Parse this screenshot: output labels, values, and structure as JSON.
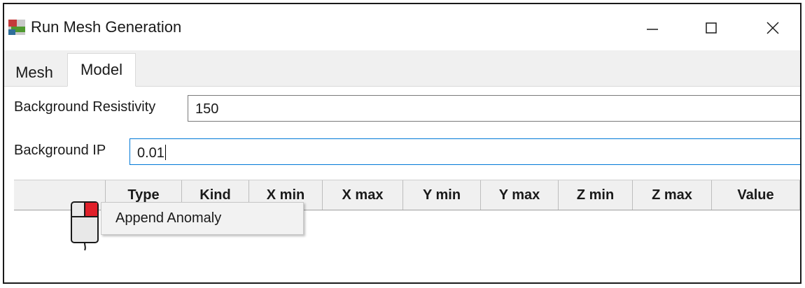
{
  "window": {
    "title": "Run Mesh Generation",
    "controls": {
      "minimize": "—",
      "maximize": "☐",
      "close": "✕"
    }
  },
  "tabs": [
    {
      "label": "Mesh",
      "selected": false
    },
    {
      "label": "Model",
      "selected": true
    }
  ],
  "model": {
    "background_resistivity_label": "Background Resistivity",
    "background_resistivity_value": "150",
    "background_ip_label": "Background IP",
    "background_ip_value": "0.01"
  },
  "grid": {
    "columns": [
      "Type",
      "Kind",
      "X min",
      "X max",
      "Y min",
      "Y max",
      "Z min",
      "Z max",
      "Value"
    ]
  },
  "context_menu": {
    "items": [
      "Append Anomaly"
    ]
  },
  "icons": {
    "app": "mesh-app-icon",
    "cursor": "mouse-right-click-icon"
  },
  "colors": {
    "focus_border": "#0078d7",
    "header_bg": "#f0f0f0",
    "mouse_button_highlight": "#e0202a"
  }
}
